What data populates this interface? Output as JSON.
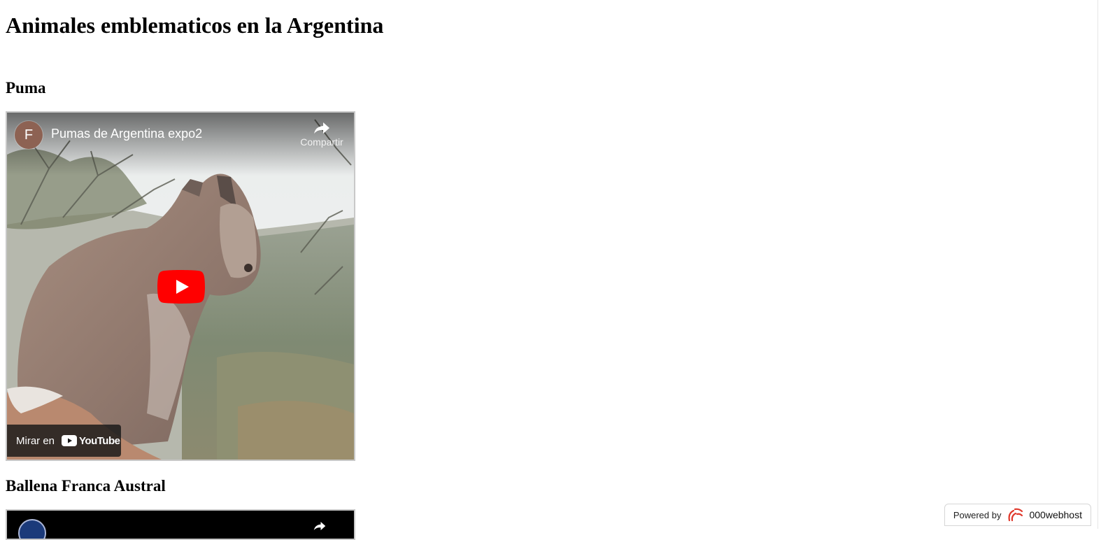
{
  "page": {
    "title": "Animales emblematicos en la Argentina"
  },
  "sections": [
    {
      "heading": "Puma",
      "video": {
        "channel_initial": "F",
        "title": "Pumas de Argentina expo2",
        "share_label": "Compartir",
        "watch_on_label": "Mirar en",
        "youtube_label": "YouTube"
      }
    },
    {
      "heading": "Ballena Franca Austral"
    }
  ],
  "footer_badge": {
    "powered_label": "Powered by",
    "brand": "000webhost"
  },
  "colors": {
    "play_button": "#ff0000",
    "avatar": "#8d6253",
    "overlay": "#171717"
  }
}
